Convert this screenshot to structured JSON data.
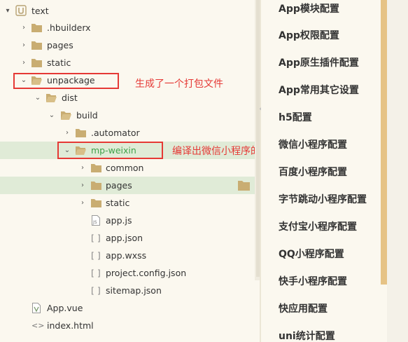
{
  "tree": {
    "items": [
      {
        "label": "text",
        "arrow": "▾",
        "icon": "project-icon"
      },
      {
        "label": ".hbuilderx",
        "arrow": "›",
        "icon": "folder-icon"
      },
      {
        "label": "pages",
        "arrow": "›",
        "icon": "folder-icon"
      },
      {
        "label": "static",
        "arrow": "›",
        "icon": "folder-icon"
      },
      {
        "label": "unpackage",
        "arrow": "⌄",
        "icon": "folder-icon"
      },
      {
        "label": "dist",
        "arrow": "⌄",
        "icon": "folder-icon"
      },
      {
        "label": "build",
        "arrow": "⌄",
        "icon": "folder-icon"
      },
      {
        "label": ".automator",
        "arrow": "›",
        "icon": "folder-icon"
      },
      {
        "label": "mp-weixin",
        "arrow": "⌄",
        "icon": "folder-icon"
      },
      {
        "label": "common",
        "arrow": "›",
        "icon": "folder-icon"
      },
      {
        "label": "pages",
        "arrow": "›",
        "icon": "folder-icon"
      },
      {
        "label": "static",
        "arrow": "›",
        "icon": "folder-icon"
      },
      {
        "label": "app.js",
        "arrow": "",
        "icon": "js-file-icon"
      },
      {
        "label": "app.json",
        "arrow": "",
        "icon": "json-file-icon"
      },
      {
        "label": "app.wxss",
        "arrow": "",
        "icon": "json-file-icon"
      },
      {
        "label": "project.config.json",
        "arrow": "",
        "icon": "json-file-icon"
      },
      {
        "label": "sitemap.json",
        "arrow": "",
        "icon": "json-file-icon"
      },
      {
        "label": "App.vue",
        "arrow": "",
        "icon": "vue-file-icon"
      },
      {
        "label": "index.html",
        "arrow": "",
        "icon": "html-file-icon"
      }
    ]
  },
  "annotations": {
    "unpackage_note": "生成了一个打包文件",
    "mpweixin_note": "编译出微信小程序的代码"
  },
  "menu": {
    "items": [
      "App模块配置",
      "App权限配置",
      "App原生插件配置",
      "App常用其它设置",
      "h5配置",
      "微信小程序配置",
      "百度小程序配置",
      "字节跳动小程序配置",
      "支付宝小程序配置",
      "QQ小程序配置",
      "快手小程序配置",
      "快应用配置",
      "uni统计配置"
    ]
  },
  "colors": {
    "background": "#fbf8ef",
    "highlight_row": "#e0ebd7",
    "annotation_red": "#e53935",
    "active_green": "#3fa14a",
    "folder": "#c9ad72",
    "menu_scrollbar": "#e6c386"
  }
}
